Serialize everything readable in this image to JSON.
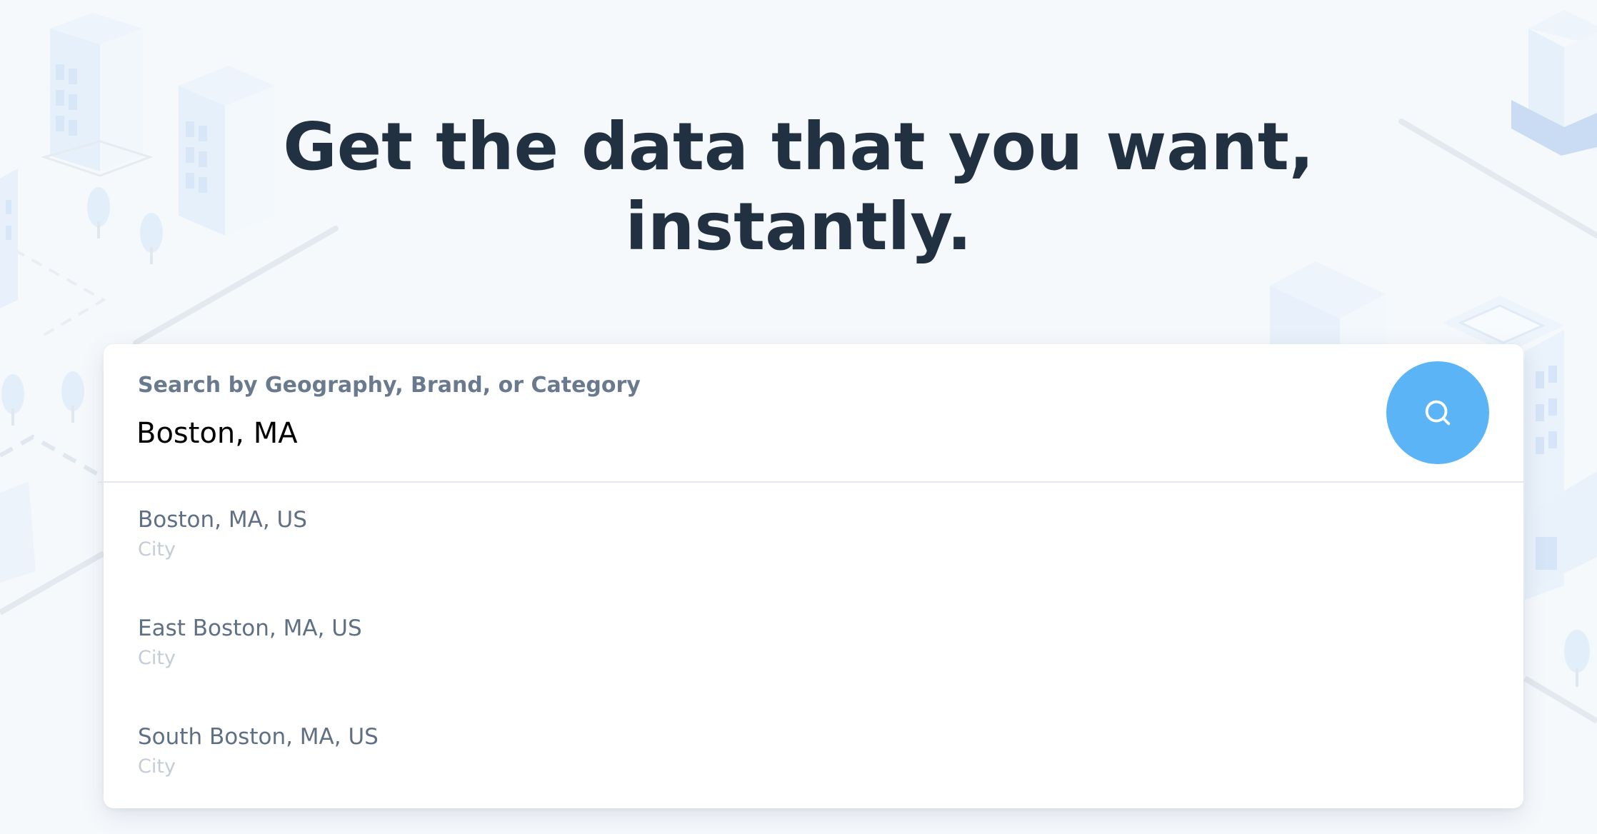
{
  "hero": {
    "headline_line1": "Get the data that you want,",
    "headline_line2": "instantly."
  },
  "search": {
    "label": "Search by Geography, Brand, or Category",
    "value": "Boston, MA",
    "button_icon": "search-icon",
    "button_color": "#5ab4f6"
  },
  "suggestions": [
    {
      "name": "Boston, MA, US",
      "type": "City"
    },
    {
      "name": "East Boston, MA, US",
      "type": "City"
    },
    {
      "name": "South Boston, MA, US",
      "type": "City"
    }
  ],
  "colors": {
    "background": "#f6f9fc",
    "headline": "#223142",
    "label": "#6a7a8e",
    "suggestion_text": "#5f6f84",
    "suggestion_type": "#c3ccd7"
  }
}
